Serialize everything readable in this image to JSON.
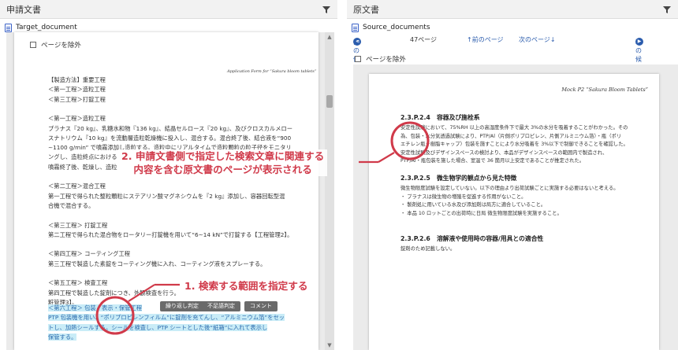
{
  "left": {
    "panel_title": "申請文書",
    "doc_name": "Target_document",
    "exclude_page": "ページを除外",
    "app_title": "Application Form for “Sakura bloom tablets”",
    "lines": [
      "【製造方法】重要工程",
      "＜第一工程＞造粒工程",
      "＜第三工程＞打錠工程",
      "",
      "＜第一工程＞造粒工程",
      "プラナス『20 kg』、乳糖水和物『136 kg』、結晶セルロース『20 kg』、及びクロスカルメロー",
      "スナトリウム『10 kg』を流動層造粒乾燥機に投入し、混合する。混合終了後、結合液を“900",
      "∼1100 g/min” で噴霧添加し造粒する。造粒中にリアルタイムで造粒顆粒の粒子径をモニタリ",
      "ングし、造粒終点における",
      "噴霧終了後、乾燥し、造粒",
      "",
      "＜第二工程＞混合工程",
      "第一工程で得られた整粒顆粒にステアリン酸マグネシウムを『2 kg』添加し、容器回転型混",
      "合機で混合する。",
      "",
      "＜第三工程＞ 打錠工程",
      "第二工程で得られた混合物をロータリー打錠機を用いて“6∼14 kN”で打錠する【工程管理2】。",
      "",
      "＜第四工程＞ コーティング工程",
      "第三工程で製造した素錠をコーティング機に入れ、コーティング液をスプレーする。",
      "",
      "＜第五工程＞ 検査工程",
      "第四工程で製造した錠剤につき、外観検査を行う。",
      "粧管理3】。"
    ],
    "hl_lines": [
      "＜第六工程＞ 包装・表示・保管工程",
      "PTP 包装機を用い、“ポリプロピレンフィルム”に錠剤を充てんし、“アルミニウム箔”をセッ",
      "トし、加熱シールする。シールを検査し、PTP シートとした後“紙箱”に入れて表示し",
      "保管する。"
    ],
    "tags": [
      "繰り返し判定",
      "不足語判定",
      "コメント"
    ]
  },
  "right": {
    "panel_title": "原文書",
    "doc_name": "Source_documents",
    "prev": "前の候補",
    "page_count": "47ページ",
    "prev_page": "↑前のページ",
    "next_page": "次のページ↓",
    "next": "次の候補",
    "exclude_page": "ページを除外",
    "mock_title": "Mock P2 “Sakura Bloom Tablets”",
    "s1": {
      "num": "2.3.P.2.4",
      "title": "容器及び施栓系"
    },
    "s1_lines": [
      "安定性試験において、75%RH 以上の高湿度条件下で最大 3%の水分を吸着することがわかった。その",
      "為、包装・水分気透過試験により、PTP/Al（片側ポリプロピレン、片側アルミニウム箔）・瓶（ポリ",
      "エチレン瓶＋樹脂キャップ）包装を施すことにより水分吸着を 3%以下で制御できることを確認した。",
      "安定性試験及びデザインスペースの検討より、本品がデザインスペースの範囲内で製造され、",
      "PTP/Al・瓶包装を施した場合、室温で 36 箇月以上安定であることが推定された。"
    ],
    "s2": {
      "num": "2.3.P.2.5",
      "title": "微生物学的観点から見た特徴"
    },
    "s2_lines": [
      "微生物限度試験を設定していない。以下の理由より出荷試験ごとに実施する必要はないと考える。",
      "・ プラナスは微生物の増殖を促進する作用がないこと。",
      "・ 製剤処に用いている水及び添加剤は局方に適合していること。",
      "・ 本品 10 ロットごとの出荷時に日局 微生物限度試験を実施すること。"
    ],
    "s3": {
      "num": "2.3.P.2.6",
      "title": "溶解液や使用時の容器/用具との適合性"
    },
    "s3_lines": [
      "錠剤のため記載しない。"
    ]
  },
  "annotations": {
    "a1": "1. 検索する範囲を指定する",
    "a2_line1": "2. 申請文書側で指定した検索文章に関連する",
    "a2_line2": "内容を含む原文書のページが表示される"
  },
  "colors": {
    "annotation": "#d03a4a",
    "highlight": "#c9ecf7",
    "link": "#2b5cad"
  }
}
